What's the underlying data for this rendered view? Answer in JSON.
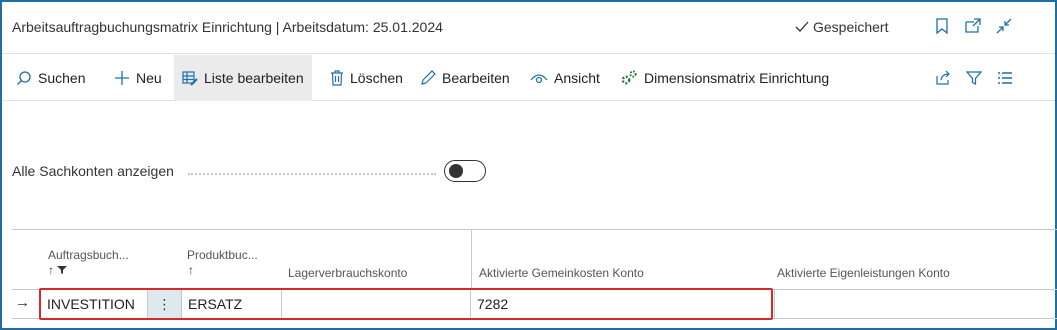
{
  "window": {
    "title": "Arbeitsauftragbuchungsmatrix Einrichtung | Arbeitsdatum: 25.01.2024",
    "status": "Gespeichert",
    "icons": [
      "bookmark-icon",
      "open-new-window-icon",
      "collapse-icon"
    ]
  },
  "actions": {
    "search": "Suchen",
    "new": "Neu",
    "edit_list": "Liste bearbeiten",
    "delete": "Löschen",
    "edit": "Bearbeiten",
    "view": "Ansicht",
    "dimensions": "Dimensionsmatrix Einrichtung",
    "right_icons": [
      "share-icon",
      "filter-icon",
      "list-view-icon"
    ]
  },
  "settings": {
    "show_all_accounts_label": "Alle Sachkonten anzeigen",
    "show_all_accounts_value": false
  },
  "table": {
    "headers": {
      "col1": "Auftragsbuch...",
      "col1_sort": "↑",
      "col2": "Produktbuc...",
      "col2_sort": "↑",
      "col3": "Lagerverbrauchskonto",
      "col4": "Aktivierte Gemeinkosten Konto",
      "col5": "Aktivierte Eigenleistungen Konto"
    },
    "rows": [
      {
        "indicator": "→",
        "auftragsbuchung": "INVESTITION",
        "menu": "⋮",
        "produktbuchung": "ERSATZ",
        "lagerverbrauchskonto": "",
        "gemeinkosten_konto": "7282",
        "eigenleistungen_konto": ""
      }
    ]
  },
  "colors": {
    "frame_border": "#1e6fa6",
    "highlight": "#d42a2a",
    "active_action_bg": "#ebebeb",
    "accent_icon": "#1f6fa8"
  }
}
